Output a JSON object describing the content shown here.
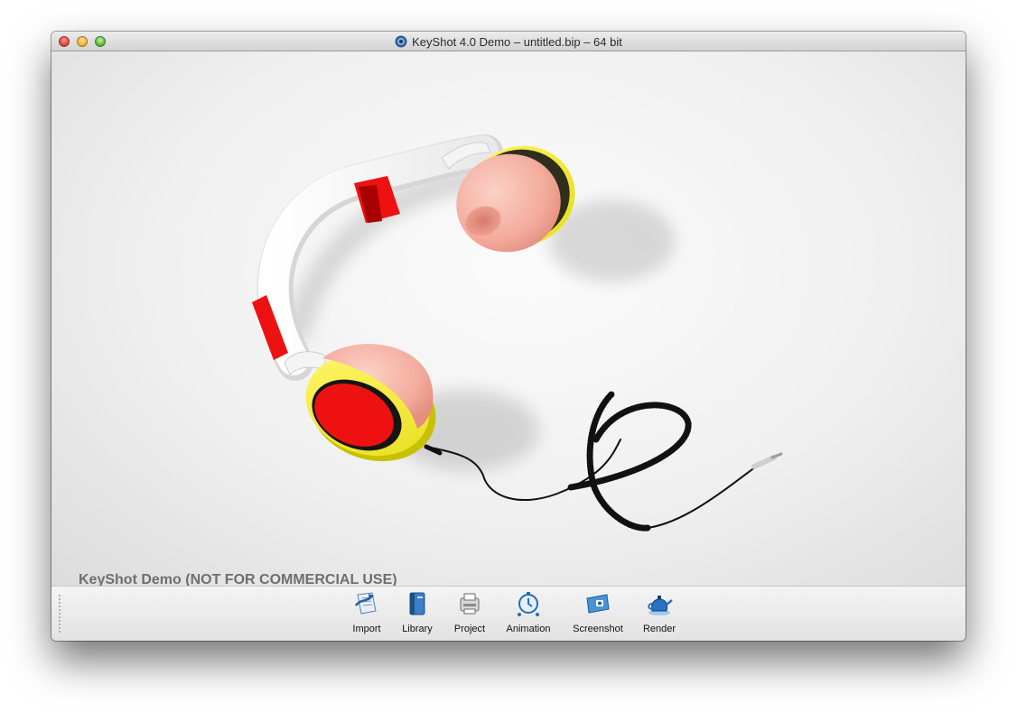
{
  "window": {
    "title": "KeyShot 4.0 Demo  – untitled.bip  – 64 bit"
  },
  "viewport": {
    "watermark": "KeyShot Demo (NOT FOR COMMERCIAL USE)",
    "scene_subject": "headphones-render"
  },
  "toolbar": {
    "items": [
      {
        "label": "Import",
        "icon": "import-icon"
      },
      {
        "label": "Library",
        "icon": "library-icon"
      },
      {
        "label": "Project",
        "icon": "project-icon"
      },
      {
        "label": "Animation",
        "icon": "animation-icon"
      },
      {
        "label": "Screenshot",
        "icon": "screenshot-icon"
      },
      {
        "label": "Render",
        "icon": "render-icon"
      }
    ]
  },
  "colors": {
    "earcup_yellow": "#f5ef3c",
    "cushion_pink": "#f4b2a4",
    "accent_red": "#ee1111",
    "band_white": "#f7f7f7",
    "cable_black": "#111111"
  }
}
